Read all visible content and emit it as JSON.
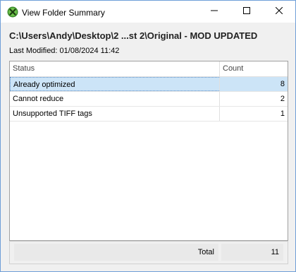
{
  "window": {
    "title": "View Folder Summary",
    "accent_color": "#6f9fd8"
  },
  "header": {
    "path": "C:\\Users\\Andy\\Desktop\\2 ...st 2\\Original - MOD UPDATED",
    "last_modified": "Last Modified: 01/08/2024 11:42"
  },
  "table": {
    "columns": [
      "Status",
      "Count"
    ],
    "rows": [
      {
        "status": "Already optimized",
        "count": "8",
        "selected": true
      },
      {
        "status": "Cannot reduce",
        "count": "2",
        "selected": false
      },
      {
        "status": "Unsupported TIFF tags",
        "count": "1",
        "selected": false
      }
    ],
    "selection_color": "#cce4f7"
  },
  "footer": {
    "total_label": "Total",
    "total_value": "11"
  },
  "icons": {
    "app": "app-logo-icon",
    "minimize": "minimize-icon",
    "maximize": "maximize-icon",
    "close": "close-icon"
  }
}
